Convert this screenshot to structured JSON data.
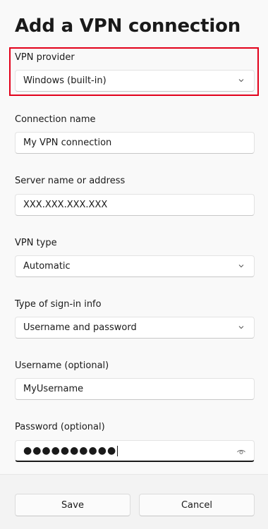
{
  "title": "Add a VPN connection",
  "fields": {
    "provider": {
      "label": "VPN provider",
      "value": "Windows (built-in)"
    },
    "connection_name": {
      "label": "Connection name",
      "value": "My VPN connection"
    },
    "server": {
      "label": "Server name or address",
      "value": "XXX.XXX.XXX.XXX"
    },
    "vpn_type": {
      "label": "VPN type",
      "value": "Automatic"
    },
    "sign_in": {
      "label": "Type of sign-in info",
      "value": "Username and password"
    },
    "username": {
      "label": "Username (optional)",
      "value": "MyUsername"
    },
    "password": {
      "label": "Password (optional)",
      "value": "●●●●●●●●●●"
    }
  },
  "buttons": {
    "save": "Save",
    "cancel": "Cancel"
  },
  "colors": {
    "highlight": "#e2001a"
  }
}
